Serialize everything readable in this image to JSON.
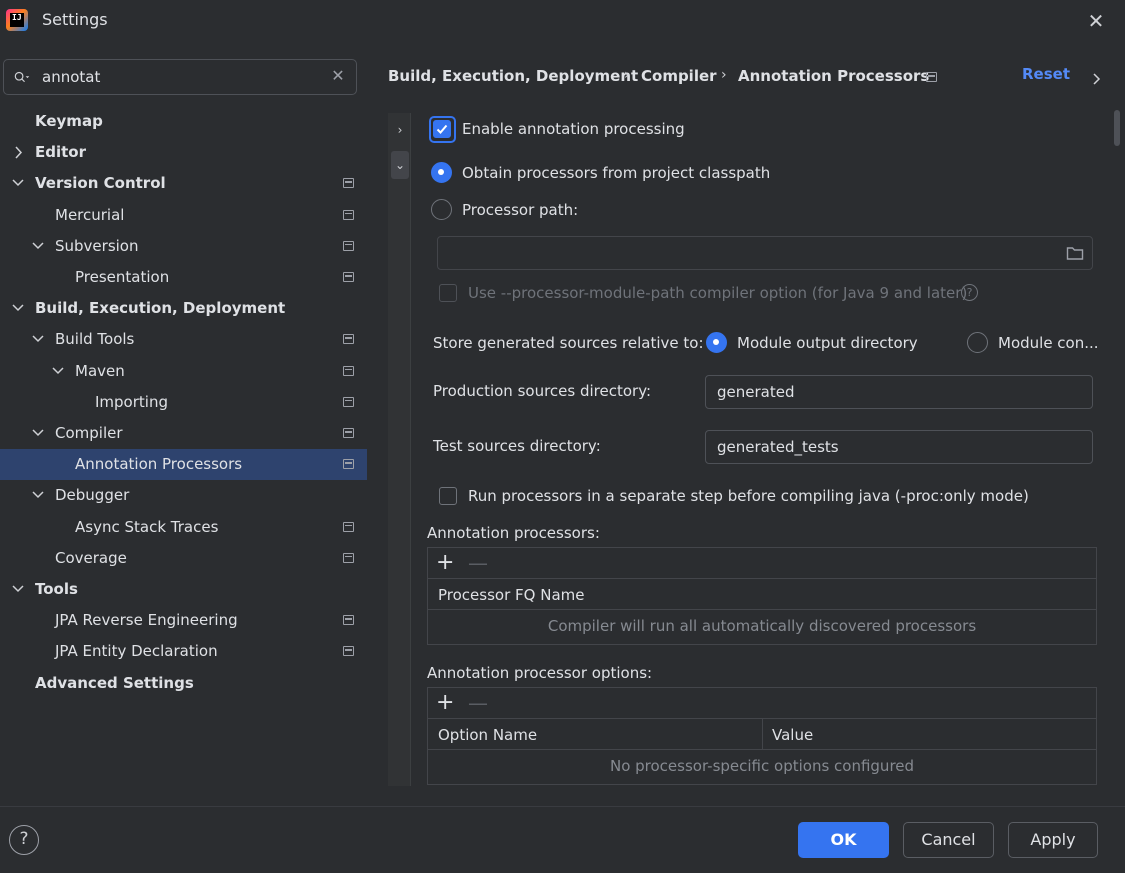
{
  "window": {
    "title": "Settings"
  },
  "search": {
    "value": "annotat"
  },
  "tree": [
    {
      "label": "Keymap",
      "bold": true,
      "indent": 0,
      "chevron": "none",
      "pin": false
    },
    {
      "label": "Editor",
      "bold": true,
      "indent": 0,
      "chevron": "right",
      "pin": false
    },
    {
      "label": "Version Control",
      "bold": true,
      "indent": 0,
      "chevron": "down",
      "pin": true
    },
    {
      "label": "Mercurial",
      "bold": false,
      "indent": 1,
      "chevron": "none",
      "pin": true
    },
    {
      "label": "Subversion",
      "bold": false,
      "indent": 1,
      "chevron": "down",
      "pin": true
    },
    {
      "label": "Presentation",
      "bold": false,
      "indent": 2,
      "chevron": "none",
      "pin": true
    },
    {
      "label": "Build, Execution, Deployment",
      "bold": true,
      "indent": 0,
      "chevron": "down",
      "pin": false
    },
    {
      "label": "Build Tools",
      "bold": false,
      "indent": 1,
      "chevron": "down",
      "pin": true
    },
    {
      "label": "Maven",
      "bold": false,
      "indent": 2,
      "chevron": "down",
      "pin": true
    },
    {
      "label": "Importing",
      "bold": false,
      "indent": 3,
      "chevron": "none",
      "pin": true
    },
    {
      "label": "Compiler",
      "bold": false,
      "indent": 1,
      "chevron": "down",
      "pin": true
    },
    {
      "label": "Annotation Processors",
      "bold": false,
      "indent": 2,
      "chevron": "none",
      "pin": true,
      "selected": true
    },
    {
      "label": "Debugger",
      "bold": false,
      "indent": 1,
      "chevron": "down",
      "pin": false
    },
    {
      "label": "Async Stack Traces",
      "bold": false,
      "indent": 2,
      "chevron": "none",
      "pin": true
    },
    {
      "label": "Coverage",
      "bold": false,
      "indent": 1,
      "chevron": "none",
      "pin": true
    },
    {
      "label": "Tools",
      "bold": true,
      "indent": 0,
      "chevron": "down",
      "pin": false
    },
    {
      "label": "JPA Reverse Engineering",
      "bold": false,
      "indent": 1,
      "chevron": "none",
      "pin": true
    },
    {
      "label": "JPA Entity Declaration",
      "bold": false,
      "indent": 1,
      "chevron": "none",
      "pin": true
    },
    {
      "label": "Advanced Settings",
      "bold": true,
      "indent": 0,
      "chevron": "none",
      "pin": false
    }
  ],
  "breadcrumb": {
    "items": [
      "Build, Execution, Deployment",
      "Compiler",
      "Annotation Processors"
    ],
    "separator": "›",
    "reset": "Reset"
  },
  "content": {
    "enable_processing": {
      "label": "Enable annotation processing",
      "checked": true
    },
    "obtain_classpath": "Obtain processors from project classpath",
    "processor_path": "Processor path:",
    "processor_path_value": "",
    "module_path_option": "Use --processor-module-path compiler option (for Java 9 and later)",
    "store_relative_label": "Store generated sources relative to:",
    "module_output": "Module output directory",
    "module_content": "Module con...",
    "production_label": "Production sources directory:",
    "production_value": "generated",
    "test_label": "Test sources directory:",
    "test_value": "generated_tests",
    "separate_step": "Run processors in a separate step before compiling java (-proc:only mode)",
    "processors_title": "Annotation processors:",
    "processors_column": "Processor FQ Name",
    "processors_empty": "Compiler will run all automatically discovered processors",
    "options_title": "Annotation processor options:",
    "options_col_name": "Option Name",
    "options_col_value": "Value",
    "options_empty": "No processor-specific options configured"
  },
  "footer": {
    "ok": "OK",
    "cancel": "Cancel",
    "apply": "Apply",
    "help": "?"
  },
  "colors": {
    "accent": "#3574f0",
    "link": "#548af7",
    "selection": "#2e436e",
    "background": "#2b2d30"
  }
}
